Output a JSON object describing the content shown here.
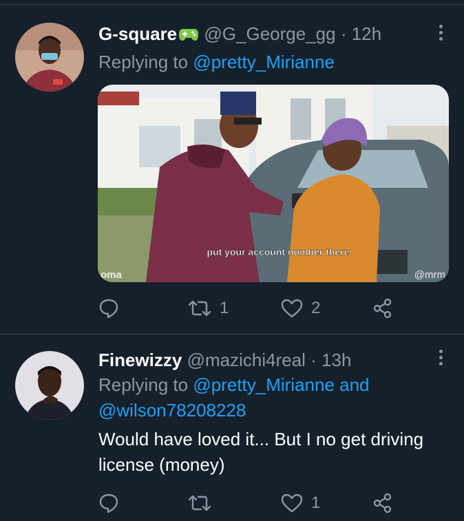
{
  "tweets": [
    {
      "name": "G-square",
      "name_emoji": "gamepad-emoji",
      "handle": "@G_George_gg",
      "separator": "·",
      "time": "12h",
      "replying_prefix": "Replying to",
      "replying_to": "@pretty_Mirianne",
      "media": {
        "caption": "put your account number there",
        "watermark_left": "oma",
        "watermark_right": "@mrm"
      },
      "actions": {
        "reply_count": "",
        "retweet_count": "1",
        "like_count": "2"
      }
    },
    {
      "name": "Finewizzy",
      "handle": "@mazichi4real",
      "separator": "·",
      "time": "13h",
      "replying_prefix": "Replying to",
      "replying_to": "@pretty_Mirianne and",
      "replying_to_2": "@wilson78208228",
      "text_line1": "Would have loved it... But I no get driving",
      "text_line2": "license (money)",
      "actions": {
        "reply_count": "",
        "retweet_count": "",
        "like_count": "1"
      }
    }
  ],
  "colors": {
    "background": "#15202b",
    "secondary_text": "#8899a6",
    "link": "#1da1f2",
    "divider": "#38444d"
  }
}
